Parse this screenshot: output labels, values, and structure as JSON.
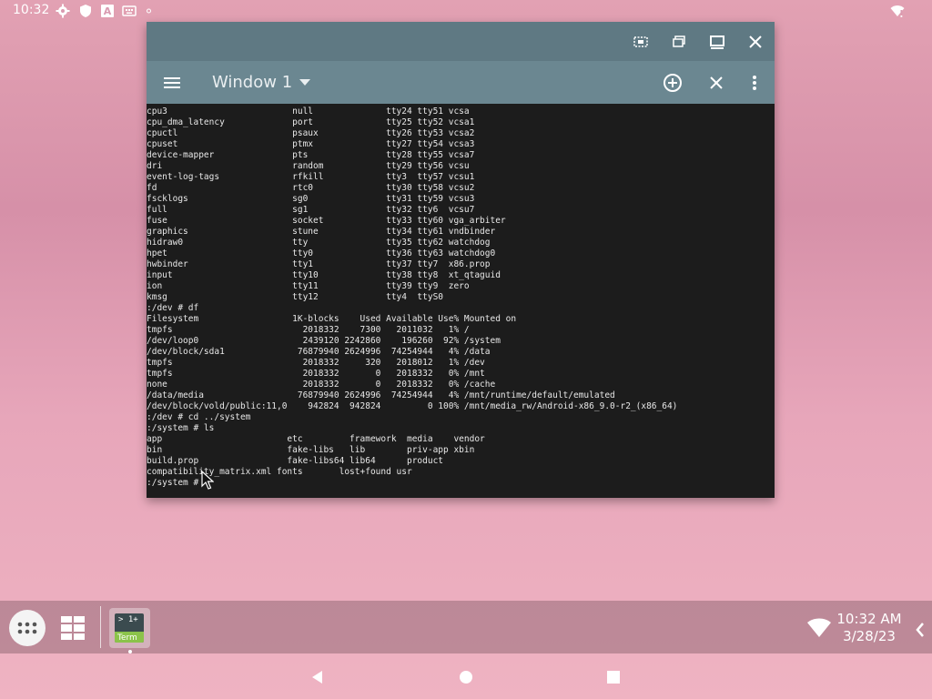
{
  "status_bar": {
    "time": "10:32",
    "icons": [
      "settings-icon",
      "shield-icon",
      "a-icon",
      "keyboard-icon",
      "dot-icon",
      "wifi-alert-icon"
    ]
  },
  "window": {
    "title": "Window 1",
    "titlebar_buttons": [
      "screenshot-icon",
      "restore-icon",
      "maximize-icon",
      "close-icon"
    ],
    "toolbar_buttons": [
      "menu-icon",
      "dropdown-arrow-icon",
      "add-window-icon",
      "close-window-icon",
      "more-icon"
    ]
  },
  "terminal": {
    "lines": [
      "cpu3                        null              tty24 tty51 vcsa",
      "cpu_dma_latency             port              tty25 tty52 vcsa1",
      "cpuctl                      psaux             tty26 tty53 vcsa2",
      "cpuset                      ptmx              tty27 tty54 vcsa3",
      "device-mapper               pts               tty28 tty55 vcsa7",
      "dri                         random            tty29 tty56 vcsu",
      "event-log-tags              rfkill            tty3  tty57 vcsu1",
      "fd                          rtc0              tty30 tty58 vcsu2",
      "fscklogs                    sg0               tty31 tty59 vcsu3",
      "full                        sg1               tty32 tty6  vcsu7",
      "fuse                        socket            tty33 tty60 vga_arbiter",
      "graphics                    stune             tty34 tty61 vndbinder",
      "hidraw0                     tty               tty35 tty62 watchdog",
      "hpet                        tty0              tty36 tty63 watchdog0",
      "hwbinder                    tty1              tty37 tty7  x86.prop",
      "input                       tty10             tty38 tty8  xt_qtaguid",
      "ion                         tty11             tty39 tty9  zero",
      "kmsg                        tty12             tty4  ttyS0",
      ":/dev # df",
      "Filesystem                  1K-blocks    Used Available Use% Mounted on",
      "tmpfs                         2018332    7300   2011032   1% /",
      "/dev/loop0                    2439120 2242860    196260  92% /system",
      "/dev/block/sda1              76879940 2624996  74254944   4% /data",
      "tmpfs                         2018332     320   2018012   1% /dev",
      "tmpfs                         2018332       0   2018332   0% /mnt",
      "none                          2018332       0   2018332   0% /cache",
      "/data/media                  76879940 2624996  74254944   4% /mnt/runtime/default/emulated",
      "/dev/block/vold/public:11,0    942824  942824         0 100% /mnt/media_rw/Android-x86_9.0-r2_(x86_64)",
      ":/dev # cd ../system",
      ":/system # ls",
      "app                        etc         framework  media    vendor",
      "bin                        fake-libs   lib        priv-app xbin",
      "build.prop                 fake-libs64 lib64      product",
      "compatibility_matrix.xml fonts       lost+found usr",
      ":/system #"
    ]
  },
  "taskbar": {
    "items": [
      "launcher-icon",
      "apps-grid-icon",
      "terminal-app"
    ],
    "terminal_app": {
      "top_text": "> 1+",
      "label": "Term"
    },
    "clock_time": "10:32 AM",
    "clock_date": "3/28/23"
  },
  "navbar": {
    "buttons": [
      "back-icon",
      "home-icon",
      "recents-icon"
    ]
  }
}
